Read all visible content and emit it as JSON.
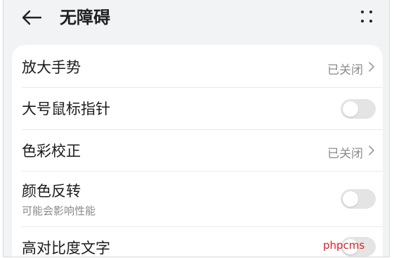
{
  "header": {
    "title": "无障碍",
    "back_icon": "arrow-left-icon",
    "more_icon": "more-dots-icon"
  },
  "settings": [
    {
      "label": "放大手势",
      "status": "已关闭",
      "control": "chevron"
    },
    {
      "label": "大号鼠标指针",
      "control": "toggle",
      "on": false
    },
    {
      "label": "色彩校正",
      "status": "已关闭",
      "control": "chevron"
    },
    {
      "label": "颜色反转",
      "sublabel": "可能会影响性能",
      "control": "toggle",
      "on": false
    },
    {
      "label": "高对比度文字",
      "control": "toggle",
      "on": false
    }
  ],
  "colors": {
    "page_background": "#f1f3f5",
    "card_background": "#ffffff",
    "toggle_off": "#e4e4e4",
    "watermark": "#e0201e"
  },
  "watermark": "phpcms"
}
